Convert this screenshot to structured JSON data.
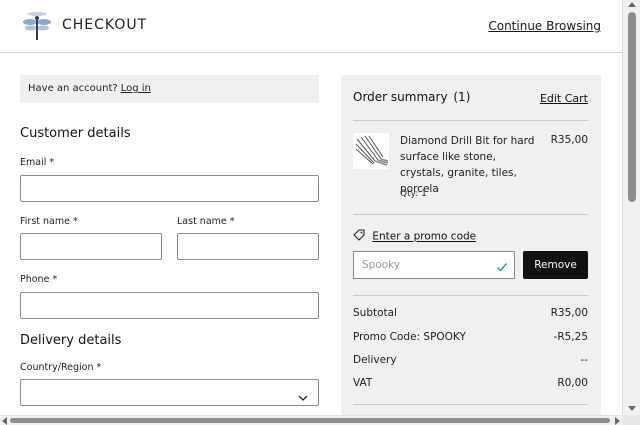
{
  "header": {
    "title": "CHECKOUT",
    "continue_label": "Continue Browsing"
  },
  "account": {
    "prompt": "Have an account?",
    "login_label": "Log in"
  },
  "customer": {
    "title": "Customer details",
    "email_label": "Email *",
    "first_name_label": "First name *",
    "last_name_label": "Last name *",
    "phone_label": "Phone *",
    "email_value": "",
    "first_name_value": "",
    "last_name_value": "",
    "phone_value": ""
  },
  "delivery": {
    "title": "Delivery details",
    "country_label": "Country/Region *",
    "country_value": ""
  },
  "summary": {
    "title": "Order summary",
    "count": "(1)",
    "edit_label": "Edit Cart",
    "product": {
      "name": "Diamond Drill Bit for hard surface like stone, crystals, granite, tiles, porcela",
      "price": "R35,00",
      "qty": "Qty: 1"
    },
    "promo_link": "Enter a promo code",
    "promo_value": "Spooky",
    "remove_label": "Remove",
    "rows": [
      {
        "label": "Subtotal",
        "value": "R35,00"
      },
      {
        "label": "Promo Code: SPOOKY",
        "value": "-R5,25"
      },
      {
        "label": "Delivery",
        "value": "--"
      },
      {
        "label": "VAT",
        "value": "R0,00"
      }
    ]
  },
  "icons": {
    "logo": "dragonfly-logo-icon",
    "tag": "tag-icon",
    "check": "check-icon",
    "caret": "chevron-down-icon"
  },
  "colors": {
    "button_bg": "#111111",
    "panel_bg": "#f0f0f0",
    "check": "#2e9c6a"
  }
}
